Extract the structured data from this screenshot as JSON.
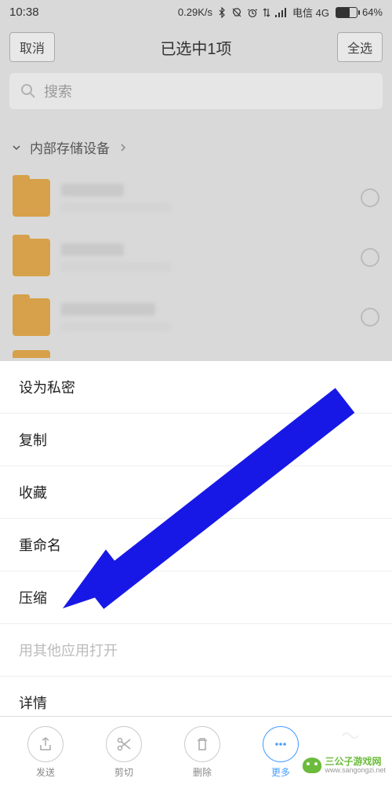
{
  "status": {
    "time": "10:38",
    "speed": "0.29K/s",
    "carrier": "电信 4G",
    "battery": "64%"
  },
  "header": {
    "cancel": "取消",
    "title": "已选中1项",
    "select_all": "全选"
  },
  "search": {
    "placeholder": "搜索"
  },
  "breadcrumb": {
    "path": "内部存储设备"
  },
  "menu": {
    "set_private": "设为私密",
    "copy": "复制",
    "favorite": "收藏",
    "rename": "重命名",
    "compress": "压缩",
    "open_with": "用其他应用打开",
    "details": "详情"
  },
  "bottom": {
    "send": "发送",
    "cut": "剪切",
    "delete": "删除",
    "more": "更多"
  },
  "watermark": {
    "name": "三公子游戏网",
    "url": "www.sangongzi.net"
  }
}
